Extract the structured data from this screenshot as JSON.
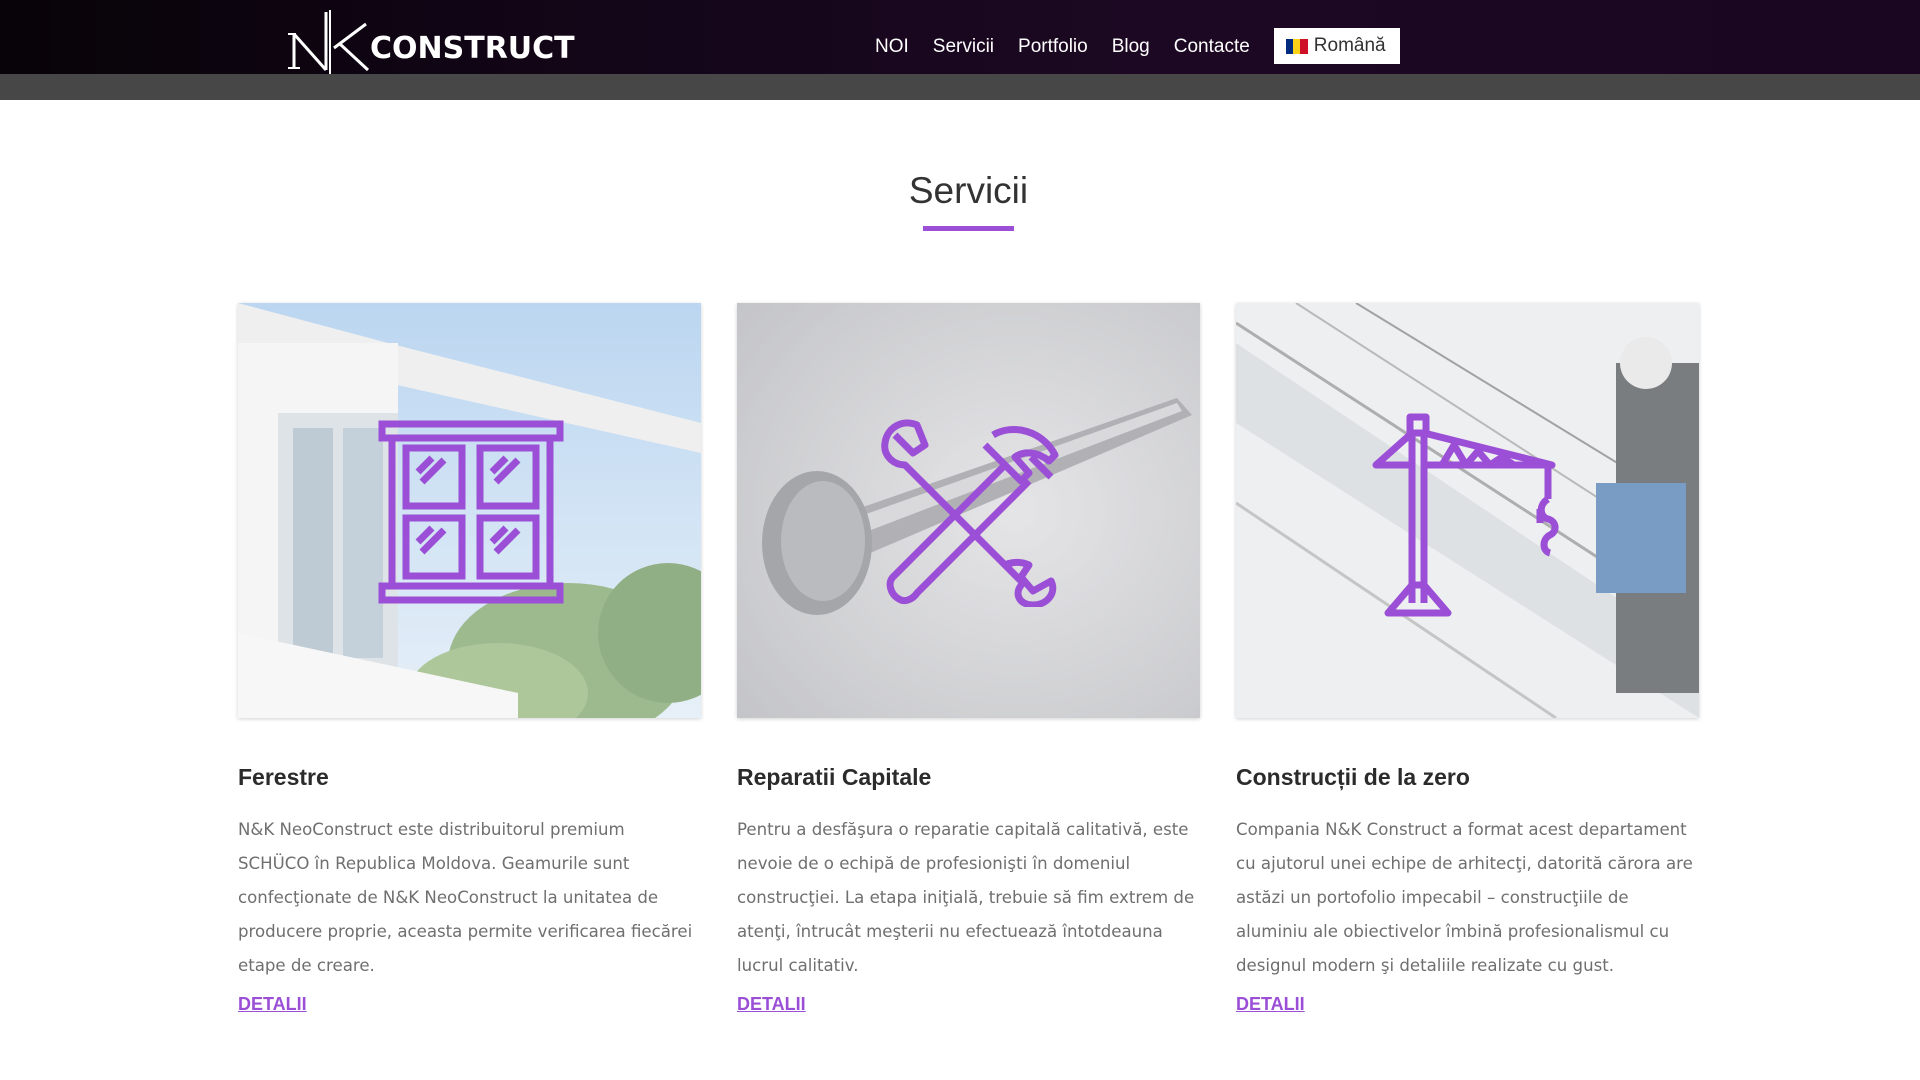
{
  "header": {
    "logo": {
      "mark": "NK",
      "text": "CONSTRUCT"
    },
    "nav": [
      {
        "label": "NOI"
      },
      {
        "label": "Servicii"
      },
      {
        "label": "Portfolio"
      },
      {
        "label": "Blog"
      },
      {
        "label": "Contacte"
      }
    ],
    "language": {
      "label": "Română",
      "flag_colors": [
        "#002b7f",
        "#fcd116",
        "#ce1126"
      ]
    }
  },
  "section": {
    "title": "Servicii"
  },
  "cards": [
    {
      "icon": "window-icon",
      "title": "Ferestre",
      "description": "N&K NeoConstruct este distribuitorul premium SCHÜCO în Republica Moldova. Geamurile sunt confecţionate de N&K NeoConstruct la unitatea de producere proprie, aceasta permite verificarea fiecărei etape de creare.",
      "link": "DETALII"
    },
    {
      "icon": "hammer-wrench-icon",
      "title": "Reparatii Capitale",
      "description": "Pentru a desfăşura o reparatie capitală calitativă, este nevoie de o echipă de profesionişti în domeniul construcţiei. La etapa iniţială, trebuie să fim extrem de atenţi, întrucât meşterii nu efectuează întotdeauna lucrul calitativ.",
      "link": "DETALII"
    },
    {
      "icon": "crane-icon",
      "title": "Construcții de la zero",
      "description": "Compania N&K Construct a format acest departament cu ajutorul unei echipe de arhitecţi, datorită cărora are astăzi un portofolio impecabil – construcţiile de aluminiu ale obiectivelor îmbină profesionalismul cu designul modern şi detaliile realizate cu gust.",
      "link": "DETALII"
    }
  ],
  "colors": {
    "accent": "#9b4fd6",
    "header_bg": "#14061a",
    "subbar": "#474747"
  }
}
